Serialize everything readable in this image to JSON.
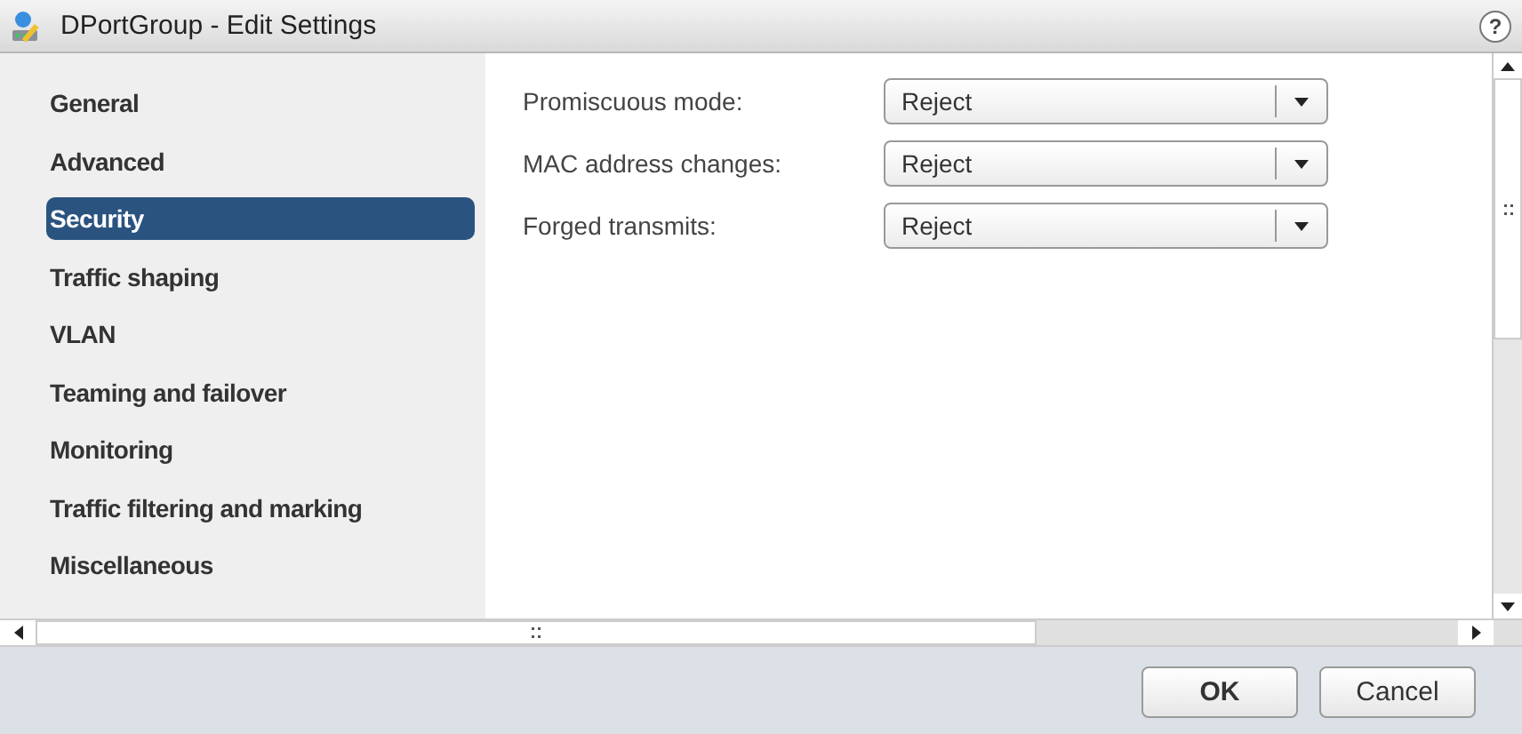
{
  "window": {
    "title": "DPortGroup - Edit Settings",
    "help": "?"
  },
  "sidebar": {
    "items": [
      {
        "label": "General",
        "selected": false
      },
      {
        "label": "Advanced",
        "selected": false
      },
      {
        "label": "Security",
        "selected": true
      },
      {
        "label": "Traffic shaping",
        "selected": false
      },
      {
        "label": "VLAN",
        "selected": false
      },
      {
        "label": "Teaming and failover",
        "selected": false
      },
      {
        "label": "Monitoring",
        "selected": false
      },
      {
        "label": "Traffic filtering and marking",
        "selected": false
      },
      {
        "label": "Miscellaneous",
        "selected": false
      }
    ]
  },
  "settings": [
    {
      "label": "Promiscuous mode:",
      "value": "Reject"
    },
    {
      "label": "MAC address changes:",
      "value": "Reject"
    },
    {
      "label": "Forged transmits:",
      "value": "Reject"
    }
  ],
  "buttons": [
    {
      "label": "OK",
      "kind": "primary"
    },
    {
      "label": "Cancel",
      "kind": "secondary"
    }
  ]
}
